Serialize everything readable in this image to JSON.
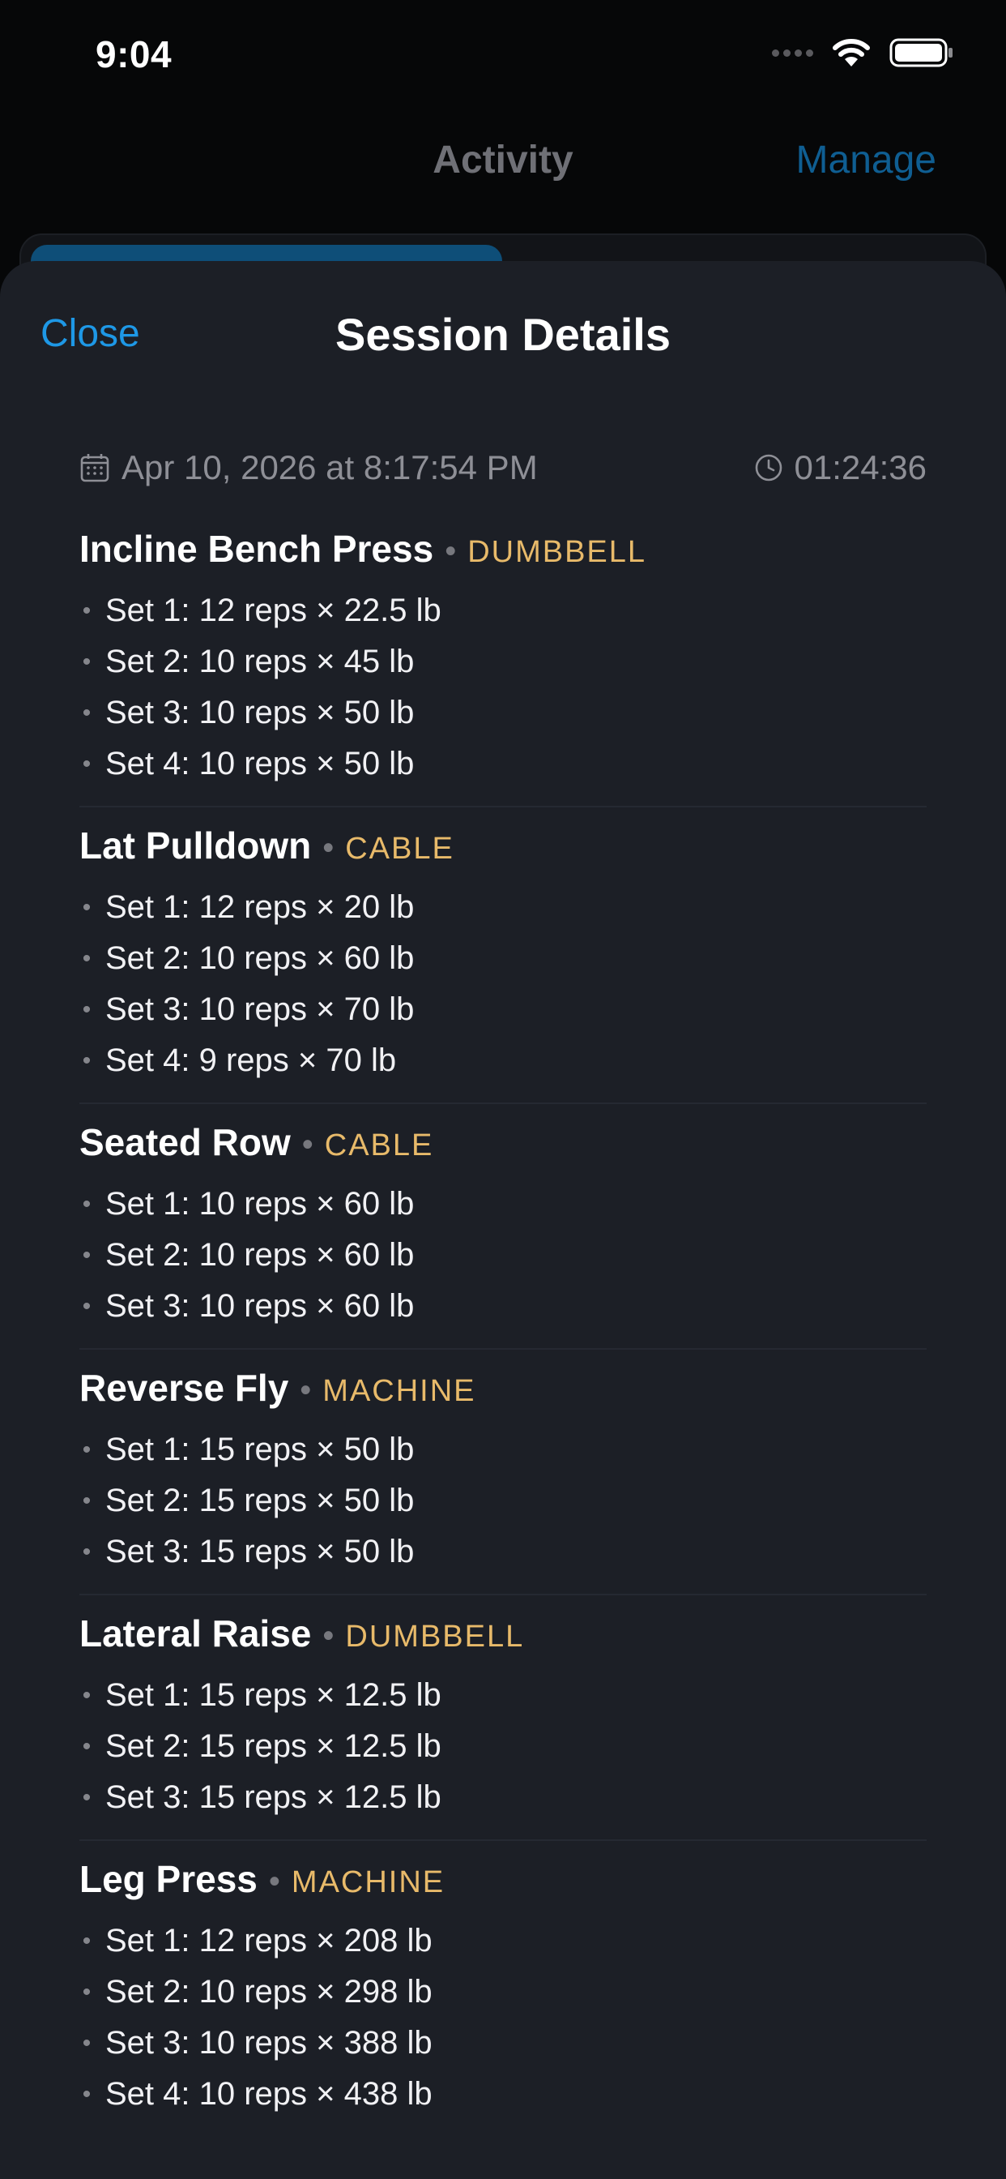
{
  "status_bar": {
    "time": "9:04"
  },
  "background": {
    "title": "Activity",
    "manage_label": "Manage"
  },
  "sheet": {
    "close_label": "Close",
    "title": "Session Details",
    "date": "Apr 10, 2026 at 8:17:54 PM",
    "duration": "01:24:36"
  },
  "exercises": [
    {
      "name": "Incline Bench Press",
      "type": "DUMBBELL",
      "sets": [
        "Set 1: 12 reps × 22.5 lb",
        "Set 2: 10 reps × 45 lb",
        "Set 3: 10 reps × 50 lb",
        "Set 4: 10 reps × 50 lb"
      ]
    },
    {
      "name": "Lat Pulldown",
      "type": "CABLE",
      "sets": [
        "Set 1: 12 reps × 20 lb",
        "Set 2: 10 reps × 60 lb",
        "Set 3: 10 reps × 70 lb",
        "Set 4: 9 reps × 70 lb"
      ]
    },
    {
      "name": "Seated Row",
      "type": "CABLE",
      "sets": [
        "Set 1: 10 reps × 60 lb",
        "Set 2: 10 reps × 60 lb",
        "Set 3: 10 reps × 60 lb"
      ]
    },
    {
      "name": "Reverse Fly",
      "type": "MACHINE",
      "sets": [
        "Set 1: 15 reps × 50 lb",
        "Set 2: 15 reps × 50 lb",
        "Set 3: 15 reps × 50 lb"
      ]
    },
    {
      "name": "Lateral Raise",
      "type": "DUMBBELL",
      "sets": [
        "Set 1: 15 reps × 12.5 lb",
        "Set 2: 15 reps × 12.5 lb",
        "Set 3: 15 reps × 12.5 lb"
      ]
    },
    {
      "name": "Leg Press",
      "type": "MACHINE",
      "sets": [
        "Set 1: 12 reps × 208 lb",
        "Set 2: 10 reps × 298 lb",
        "Set 3: 10 reps × 388 lb",
        "Set 4: 10 reps × 438 lb"
      ]
    }
  ],
  "colors": {
    "accent": "#1e98e6",
    "equipment": "#e8ba6a",
    "sheet_background": "#1c1f26"
  },
  "icons": {
    "date": "calendar-icon",
    "duration": "clock-icon"
  }
}
